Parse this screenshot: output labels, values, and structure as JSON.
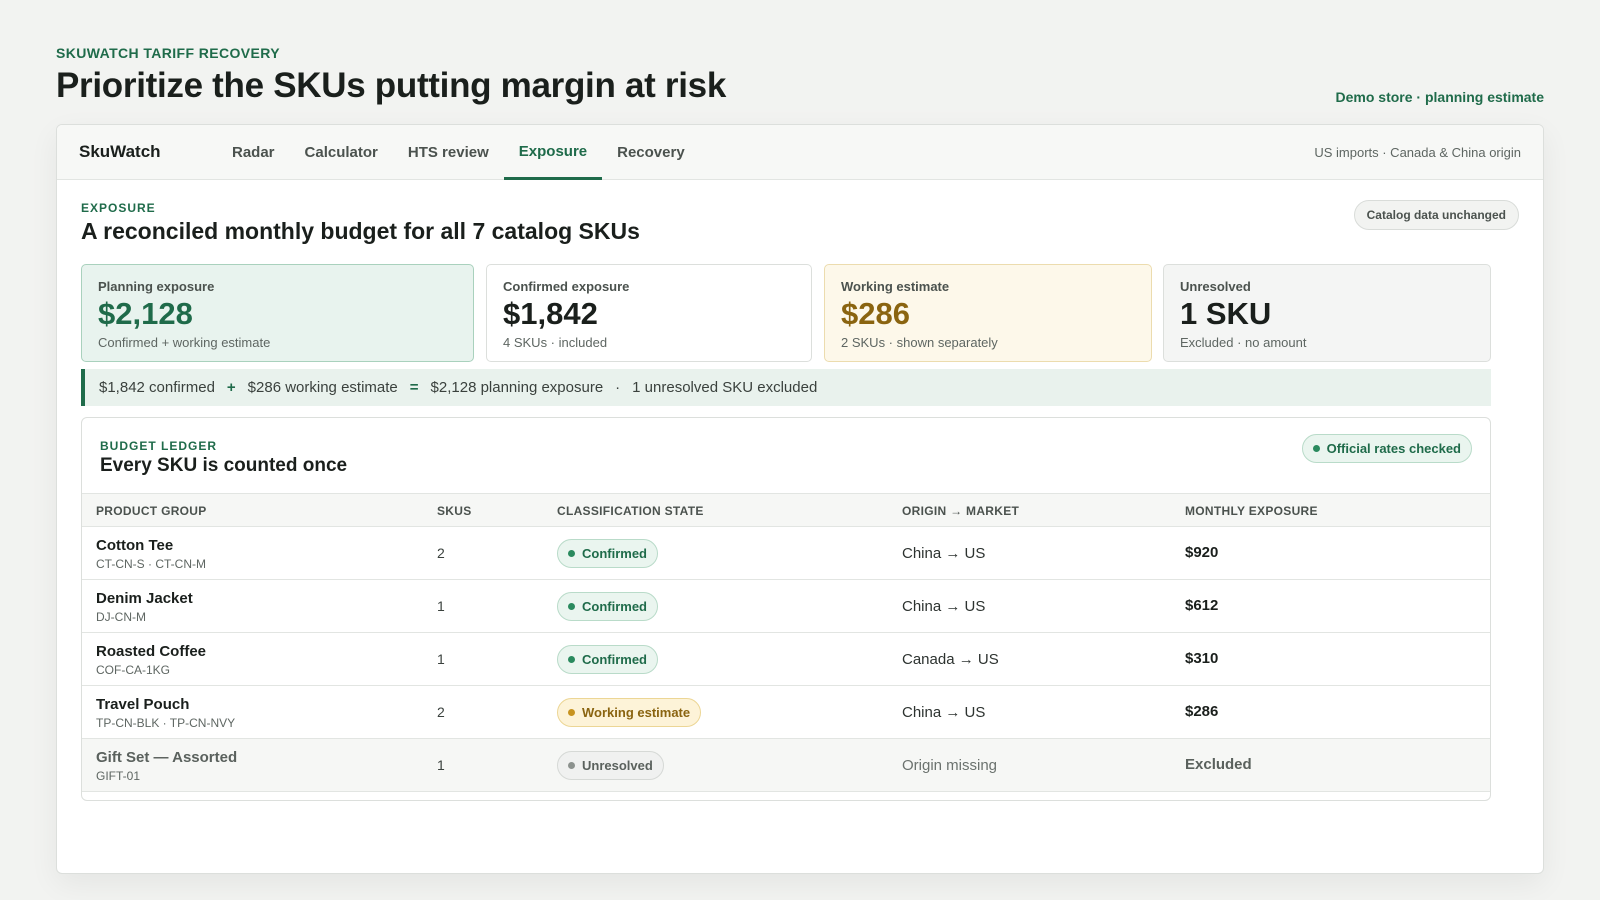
{
  "hero": {
    "eyebrow": "SKUWATCH TARIFF RECOVERY",
    "title": "Prioritize the SKUs putting margin at risk",
    "note": "Demo store · planning estimate"
  },
  "app": {
    "brand": "SkuWatch",
    "nav": [
      {
        "label": "Radar",
        "active": false
      },
      {
        "label": "Calculator",
        "active": false
      },
      {
        "label": "HTS review",
        "active": false
      },
      {
        "label": "Exposure",
        "active": true
      },
      {
        "label": "Recovery",
        "active": false
      }
    ],
    "context": "US imports · Canada & China origin"
  },
  "section": {
    "eyebrow": "EXPOSURE",
    "title": "A reconciled monthly budget for all 7 catalog SKUs",
    "status_pill": "Catalog data unchanged"
  },
  "cards": [
    {
      "label": "Planning exposure",
      "value": "$2,128",
      "sub": "Confirmed + working estimate",
      "tone": "green"
    },
    {
      "label": "Confirmed exposure",
      "value": "$1,842",
      "sub": "4 SKUs · included",
      "tone": "plain"
    },
    {
      "label": "Working estimate",
      "value": "$286",
      "sub": "2 SKUs · shown separately",
      "tone": "amber"
    },
    {
      "label": "Unresolved",
      "value": "1 SKU",
      "sub": "Excluded · no amount",
      "tone": "grey"
    }
  ],
  "formula": {
    "confirmed": "$1,842 confirmed",
    "plus": "+",
    "working": "$286 working estimate",
    "equals": "=",
    "total": "$2,128 planning exposure",
    "sep": "·",
    "excluded": "1 unresolved SKU excluded"
  },
  "ledger": {
    "eyebrow": "BUDGET LEDGER",
    "title": "Every SKU is counted once",
    "status_pill": "Official rates checked",
    "columns": [
      "PRODUCT GROUP",
      "SKUS",
      "CLASSIFICATION STATE",
      "ORIGIN → MARKET",
      "MONTHLY EXPOSURE"
    ],
    "rows": [
      {
        "name": "Cotton Tee",
        "skus_list": "CT-CN-S · CT-CN-M",
        "count": "2",
        "state": "Confirmed",
        "state_kind": "confirmed",
        "origin": "China → US",
        "exposure": "$920"
      },
      {
        "name": "Denim Jacket",
        "skus_list": "DJ-CN-M",
        "count": "1",
        "state": "Confirmed",
        "state_kind": "confirmed",
        "origin": "China → US",
        "exposure": "$612"
      },
      {
        "name": "Roasted Coffee",
        "skus_list": "COF-CA-1KG",
        "count": "1",
        "state": "Confirmed",
        "state_kind": "confirmed",
        "origin": "Canada → US",
        "exposure": "$310"
      },
      {
        "name": "Travel Pouch",
        "skus_list": "TP-CN-BLK · TP-CN-NVY",
        "count": "2",
        "state": "Working estimate",
        "state_kind": "working",
        "origin": "China → US",
        "exposure": "$286"
      },
      {
        "name": "Gift Set — Assorted",
        "skus_list": "GIFT-01",
        "count": "1",
        "state": "Unresolved",
        "state_kind": "unresolved",
        "origin": "Origin missing",
        "exposure": "Excluded"
      }
    ]
  },
  "colors": {
    "accent": "#1f6b4a",
    "amber": "#8a6410",
    "background": "#f2f3f1"
  }
}
